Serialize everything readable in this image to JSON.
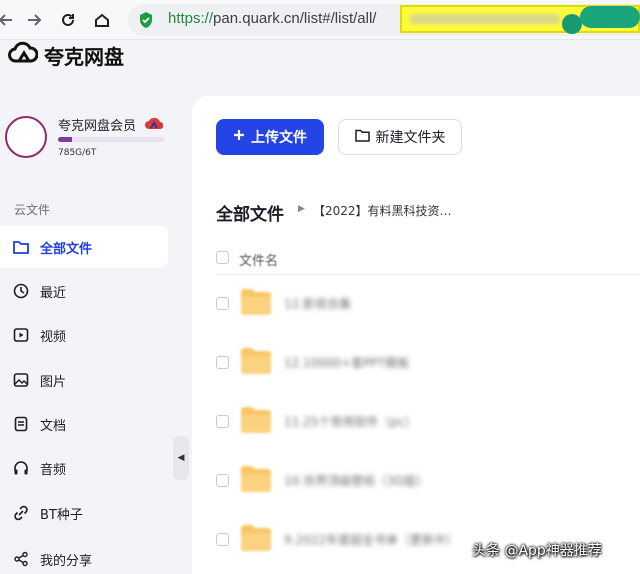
{
  "browser": {
    "url_secure": "https://",
    "url_host": "pan.quark.cn",
    "url_path": "/list#/list/all/"
  },
  "app": {
    "name": "夸克网盘"
  },
  "user": {
    "membership": "夸克网盘会员",
    "storage": "785G/6T",
    "storage_fraction": 0.13
  },
  "sidebar": {
    "section_title": "云文件",
    "items": [
      {
        "label": "全部文件",
        "icon": "folder-icon",
        "active": true
      },
      {
        "label": "最近",
        "icon": "clock-icon"
      },
      {
        "label": "视频",
        "icon": "video-icon"
      },
      {
        "label": "图片",
        "icon": "image-icon"
      },
      {
        "label": "文档",
        "icon": "document-icon"
      },
      {
        "label": "音频",
        "icon": "headphones-icon"
      },
      {
        "label": "BT种子",
        "icon": "bt-seed-icon"
      },
      {
        "label": "我的分享",
        "icon": "share-icon"
      }
    ]
  },
  "toolbar": {
    "upload_label": "上传文件",
    "new_folder_label": "新建文件夹"
  },
  "breadcrumb": {
    "root": "全部文件",
    "path": "【2022】有料黑科技资…"
  },
  "file_list": {
    "column_name": "文件名",
    "rows": [
      {
        "name": "12.影视合集"
      },
      {
        "name": "12.10000+套PPT模板"
      },
      {
        "name": "11.25个常用软件（pc）"
      },
      {
        "name": "10.世界顶级壁纸（3D版）"
      },
      {
        "name": "9.2022年度超全书单（更新中）"
      }
    ]
  },
  "colors": {
    "accent": "#2544e6",
    "url_green": "#1f8a3a",
    "folder": "#f9c665",
    "highlight": "#fffb3a"
  },
  "watermark": "头条 @App神器推荐"
}
